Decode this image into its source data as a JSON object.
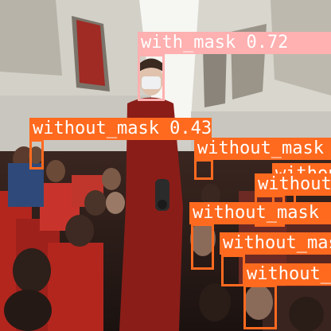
{
  "image": {
    "description_colors": {
      "cabin_wall": "#e9e7e1",
      "seat_red": "#b3261e",
      "uniform_red": "#8a1d18",
      "bin_gray": "#d4d2c9"
    }
  },
  "detections": [
    {
      "label": "with_mask 0.72",
      "color": "#ffb0b0"
    },
    {
      "label": "without_mask 0.43",
      "color": "#ff6a1f"
    },
    {
      "label": "without_mask",
      "color": "#ff6a1f"
    },
    {
      "label": "without_mask",
      "color": "#ff6a1f"
    },
    {
      "label": "without_mask",
      "color": "#ff6a1f"
    },
    {
      "label": "without_mask",
      "color": "#ff6a1f"
    },
    {
      "label": "without_mask",
      "color": "#ff6a1f"
    },
    {
      "label": "without_mask",
      "color": "#ff6a1f"
    }
  ]
}
